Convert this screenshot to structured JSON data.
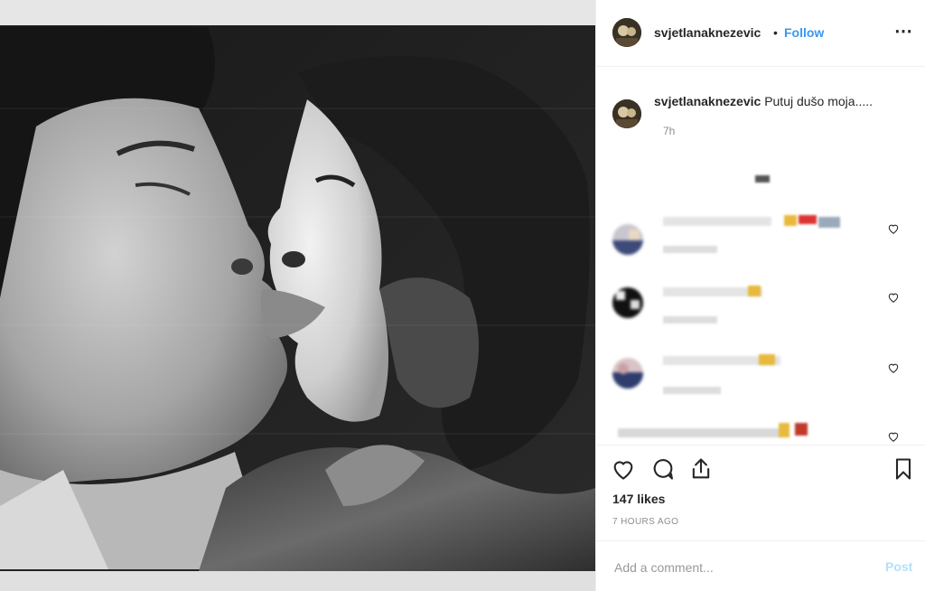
{
  "header": {
    "username": "svjetlanaknezevic",
    "separator": "•",
    "follow_label": "Follow",
    "more_icon": "more-options-icon"
  },
  "caption": {
    "username": "svjetlanaknezevic",
    "text": "Putuj dušo moja.....",
    "time": "7h"
  },
  "actions": {
    "like_icon": "heart-outline-icon",
    "comment_icon": "comment-bubble-icon",
    "share_icon": "share-icon",
    "save_icon": "bookmark-icon"
  },
  "likes": "147 likes",
  "timestamp": "7 HOURS AGO",
  "add_comment": {
    "placeholder": "Add a comment...",
    "post_label": "Post"
  },
  "colors": {
    "follow": "#3897f0",
    "post_disabled": "#b2dffc",
    "muted": "#8e8e8e"
  }
}
